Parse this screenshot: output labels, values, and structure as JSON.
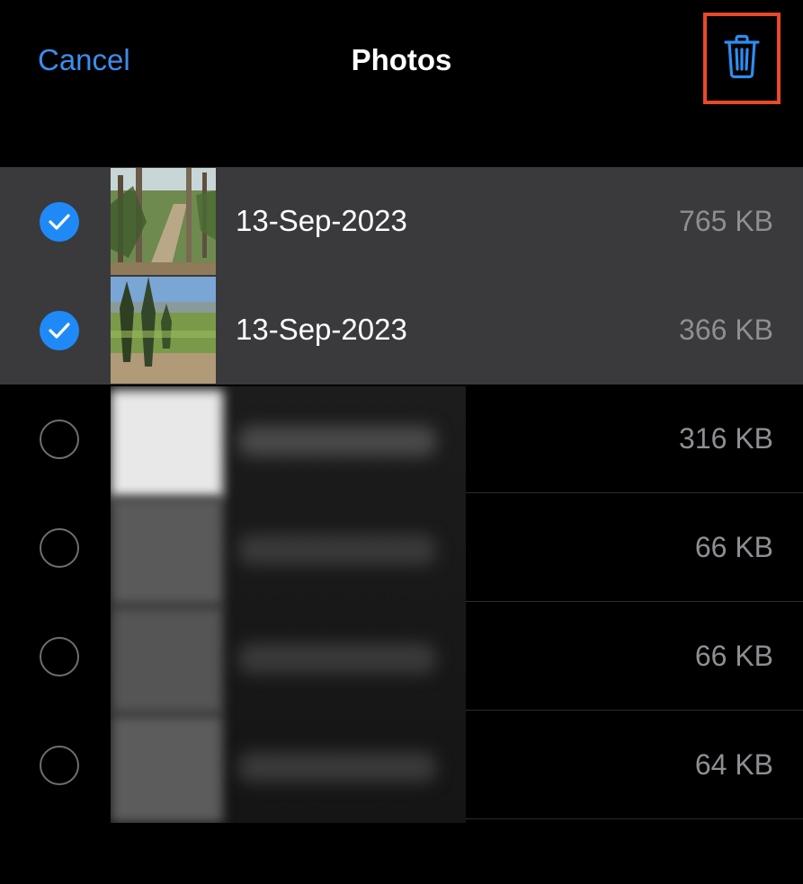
{
  "navbar": {
    "cancel_label": "Cancel",
    "title": "Photos",
    "delete_icon": "trash-icon",
    "accent_color": "#3b8eed",
    "highlight_color": "#e8492a"
  },
  "rows": [
    {
      "date": "13-Sep-2023",
      "size": "765 KB",
      "selected": true
    },
    {
      "date": "13-Sep-2023",
      "size": "366 KB",
      "selected": true
    },
    {
      "date": "",
      "size": "316 KB",
      "selected": false
    },
    {
      "date": "",
      "size": "66 KB",
      "selected": false
    },
    {
      "date": "",
      "size": "66 KB",
      "selected": false
    },
    {
      "date": "",
      "size": "64 KB",
      "selected": false
    }
  ]
}
